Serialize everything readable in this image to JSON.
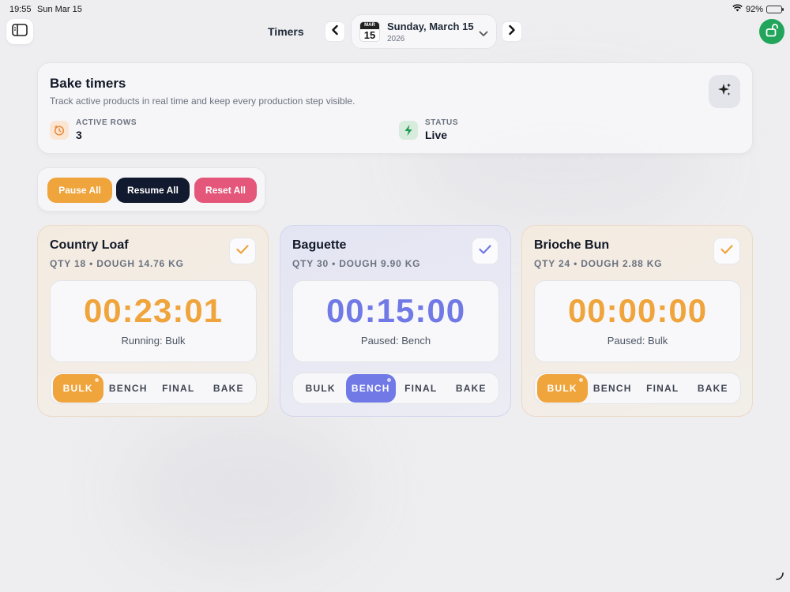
{
  "status_bar": {
    "time": "19:55",
    "date": "Sun Mar 15",
    "battery": "92%",
    "battery_level": 0.92
  },
  "nav": {
    "title": "Timers",
    "date_main": "Sunday, March 15",
    "date_year": "2026",
    "calendar_month": "MAR",
    "calendar_day": "15"
  },
  "header": {
    "title": "Bake timers",
    "subtitle": "Track active products in real time and keep every production step visible.",
    "stats": [
      {
        "label": "ACTIVE ROWS",
        "value": "3",
        "icon": "timer-icon"
      },
      {
        "label": "STATUS",
        "value": "Live",
        "icon": "bolt-icon"
      }
    ]
  },
  "actions": {
    "pause_all": "Pause All",
    "resume_all": "Resume All",
    "reset_all": "Reset All"
  },
  "cards": [
    {
      "name": "Country Loaf",
      "meta": "QTY 18 • DOUGH 14.76 KG",
      "time": "00:23:01",
      "status": "Running: Bulk",
      "accent": "#efa43c",
      "stages": [
        "BULK",
        "BENCH",
        "FINAL",
        "BAKE"
      ],
      "active_stage": "BULK",
      "checked": true
    },
    {
      "name": "Baguette",
      "meta": "QTY 30 • DOUGH 9.90 KG",
      "time": "00:15:00",
      "status": "Paused: Bench",
      "accent": "#7079e6",
      "stages": [
        "BULK",
        "BENCH",
        "FINAL",
        "BAKE"
      ],
      "active_stage": "BENCH",
      "checked": true
    },
    {
      "name": "Brioche Bun",
      "meta": "QTY 24 • DOUGH 2.88 KG",
      "time": "00:00:00",
      "status": "Paused: Bulk",
      "accent": "#efa43c",
      "stages": [
        "BULK",
        "BENCH",
        "FINAL",
        "BAKE"
      ],
      "active_stage": "BULK",
      "checked": true
    }
  ],
  "colors": {
    "orange": "#efa43c",
    "blue": "#7079e6",
    "navy": "#111a2e",
    "pink": "#e4577a",
    "green": "#22a55b"
  }
}
